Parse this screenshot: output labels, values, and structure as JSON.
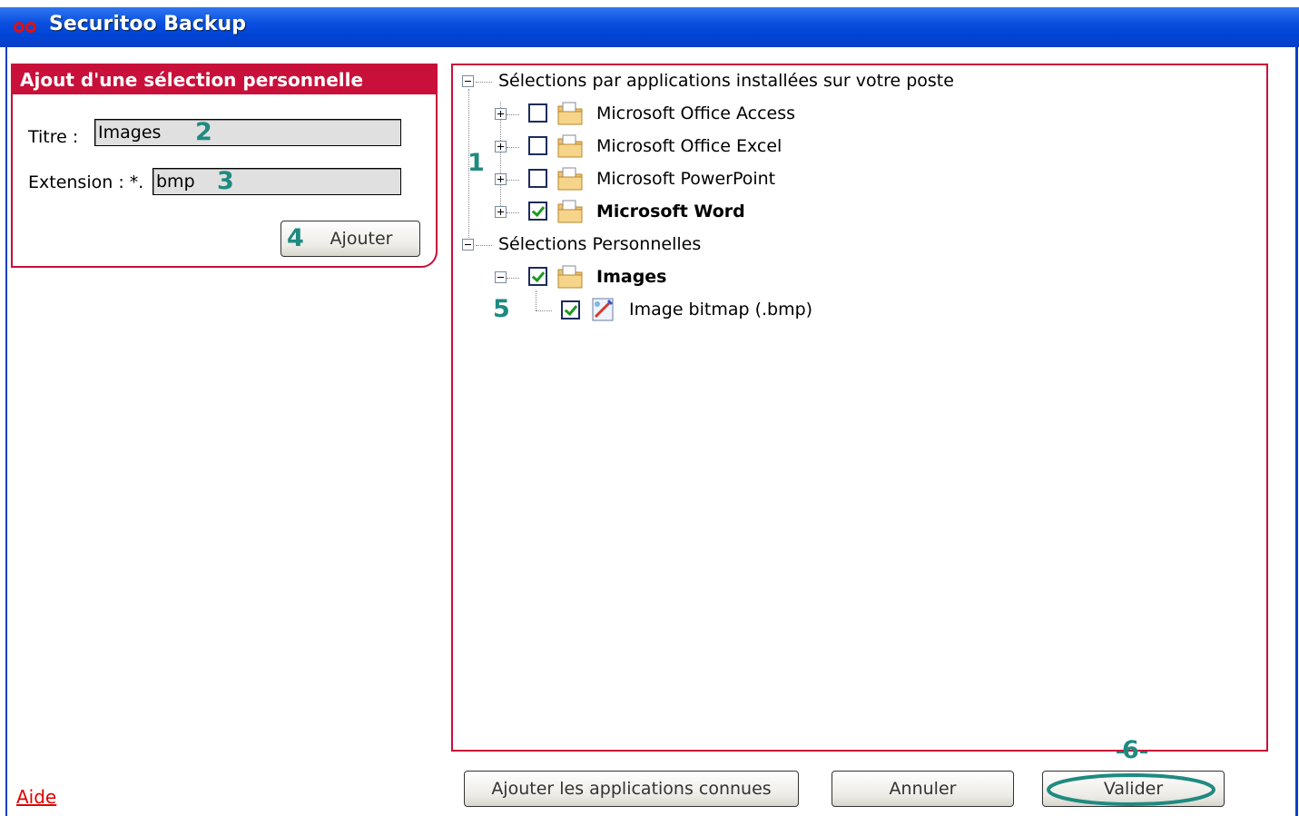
{
  "window": {
    "title": "Securitoo Backup"
  },
  "add_panel": {
    "header": "Ajout d'une sélection personnelle",
    "title_label": "Titre :",
    "title_value": "Images",
    "extension_label": "Extension : *.",
    "extension_value": "bmp",
    "add_button": "Ajouter"
  },
  "tree": {
    "group1": {
      "label": "Sélections par applications installées sur votre poste",
      "items": [
        {
          "label": "Microsoft Office Access",
          "checked": false
        },
        {
          "label": "Microsoft Office Excel",
          "checked": false
        },
        {
          "label": "Microsoft PowerPoint",
          "checked": false
        },
        {
          "label": "Microsoft Word",
          "checked": true
        }
      ]
    },
    "group2": {
      "label": "Sélections Personnelles",
      "items": [
        {
          "label": "Images",
          "checked": true,
          "children": [
            {
              "label": "Image bitmap (.bmp)",
              "checked": true
            }
          ]
        }
      ]
    }
  },
  "annotations": {
    "n1": "1",
    "n2": "2",
    "n3": "3",
    "n4": "4",
    "n5": "5",
    "n6": "6"
  },
  "buttons": {
    "add_known": "Ajouter les applications connues",
    "cancel": "Annuler",
    "validate": "Valider"
  },
  "help_link": "Aide",
  "colors": {
    "accent": "#c8103a",
    "annotation": "#1f8a80",
    "titlebar": "#0a4fe0"
  }
}
